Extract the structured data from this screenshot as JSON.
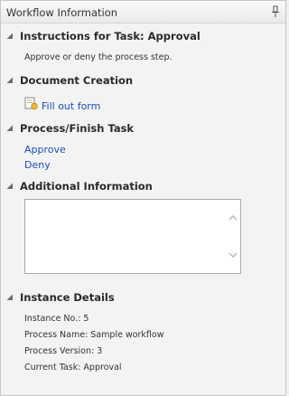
{
  "panel": {
    "title": "Workflow Information"
  },
  "sections": {
    "instructions": {
      "title": "Instructions for Task: Approval",
      "text": "Approve or deny the process step."
    },
    "document_creation": {
      "title": "Document Creation",
      "link": "Fill out form"
    },
    "process_finish": {
      "title": "Process/Finish Task",
      "links": [
        "Approve",
        "Deny"
      ]
    },
    "additional_info": {
      "title": "Additional Information",
      "value": ""
    },
    "instance_details": {
      "title": "Instance Details",
      "lines": [
        "Instance No.: 5",
        "Process Name: Sample workflow",
        "Process Version: 3",
        "Current Task: Approval"
      ]
    }
  }
}
